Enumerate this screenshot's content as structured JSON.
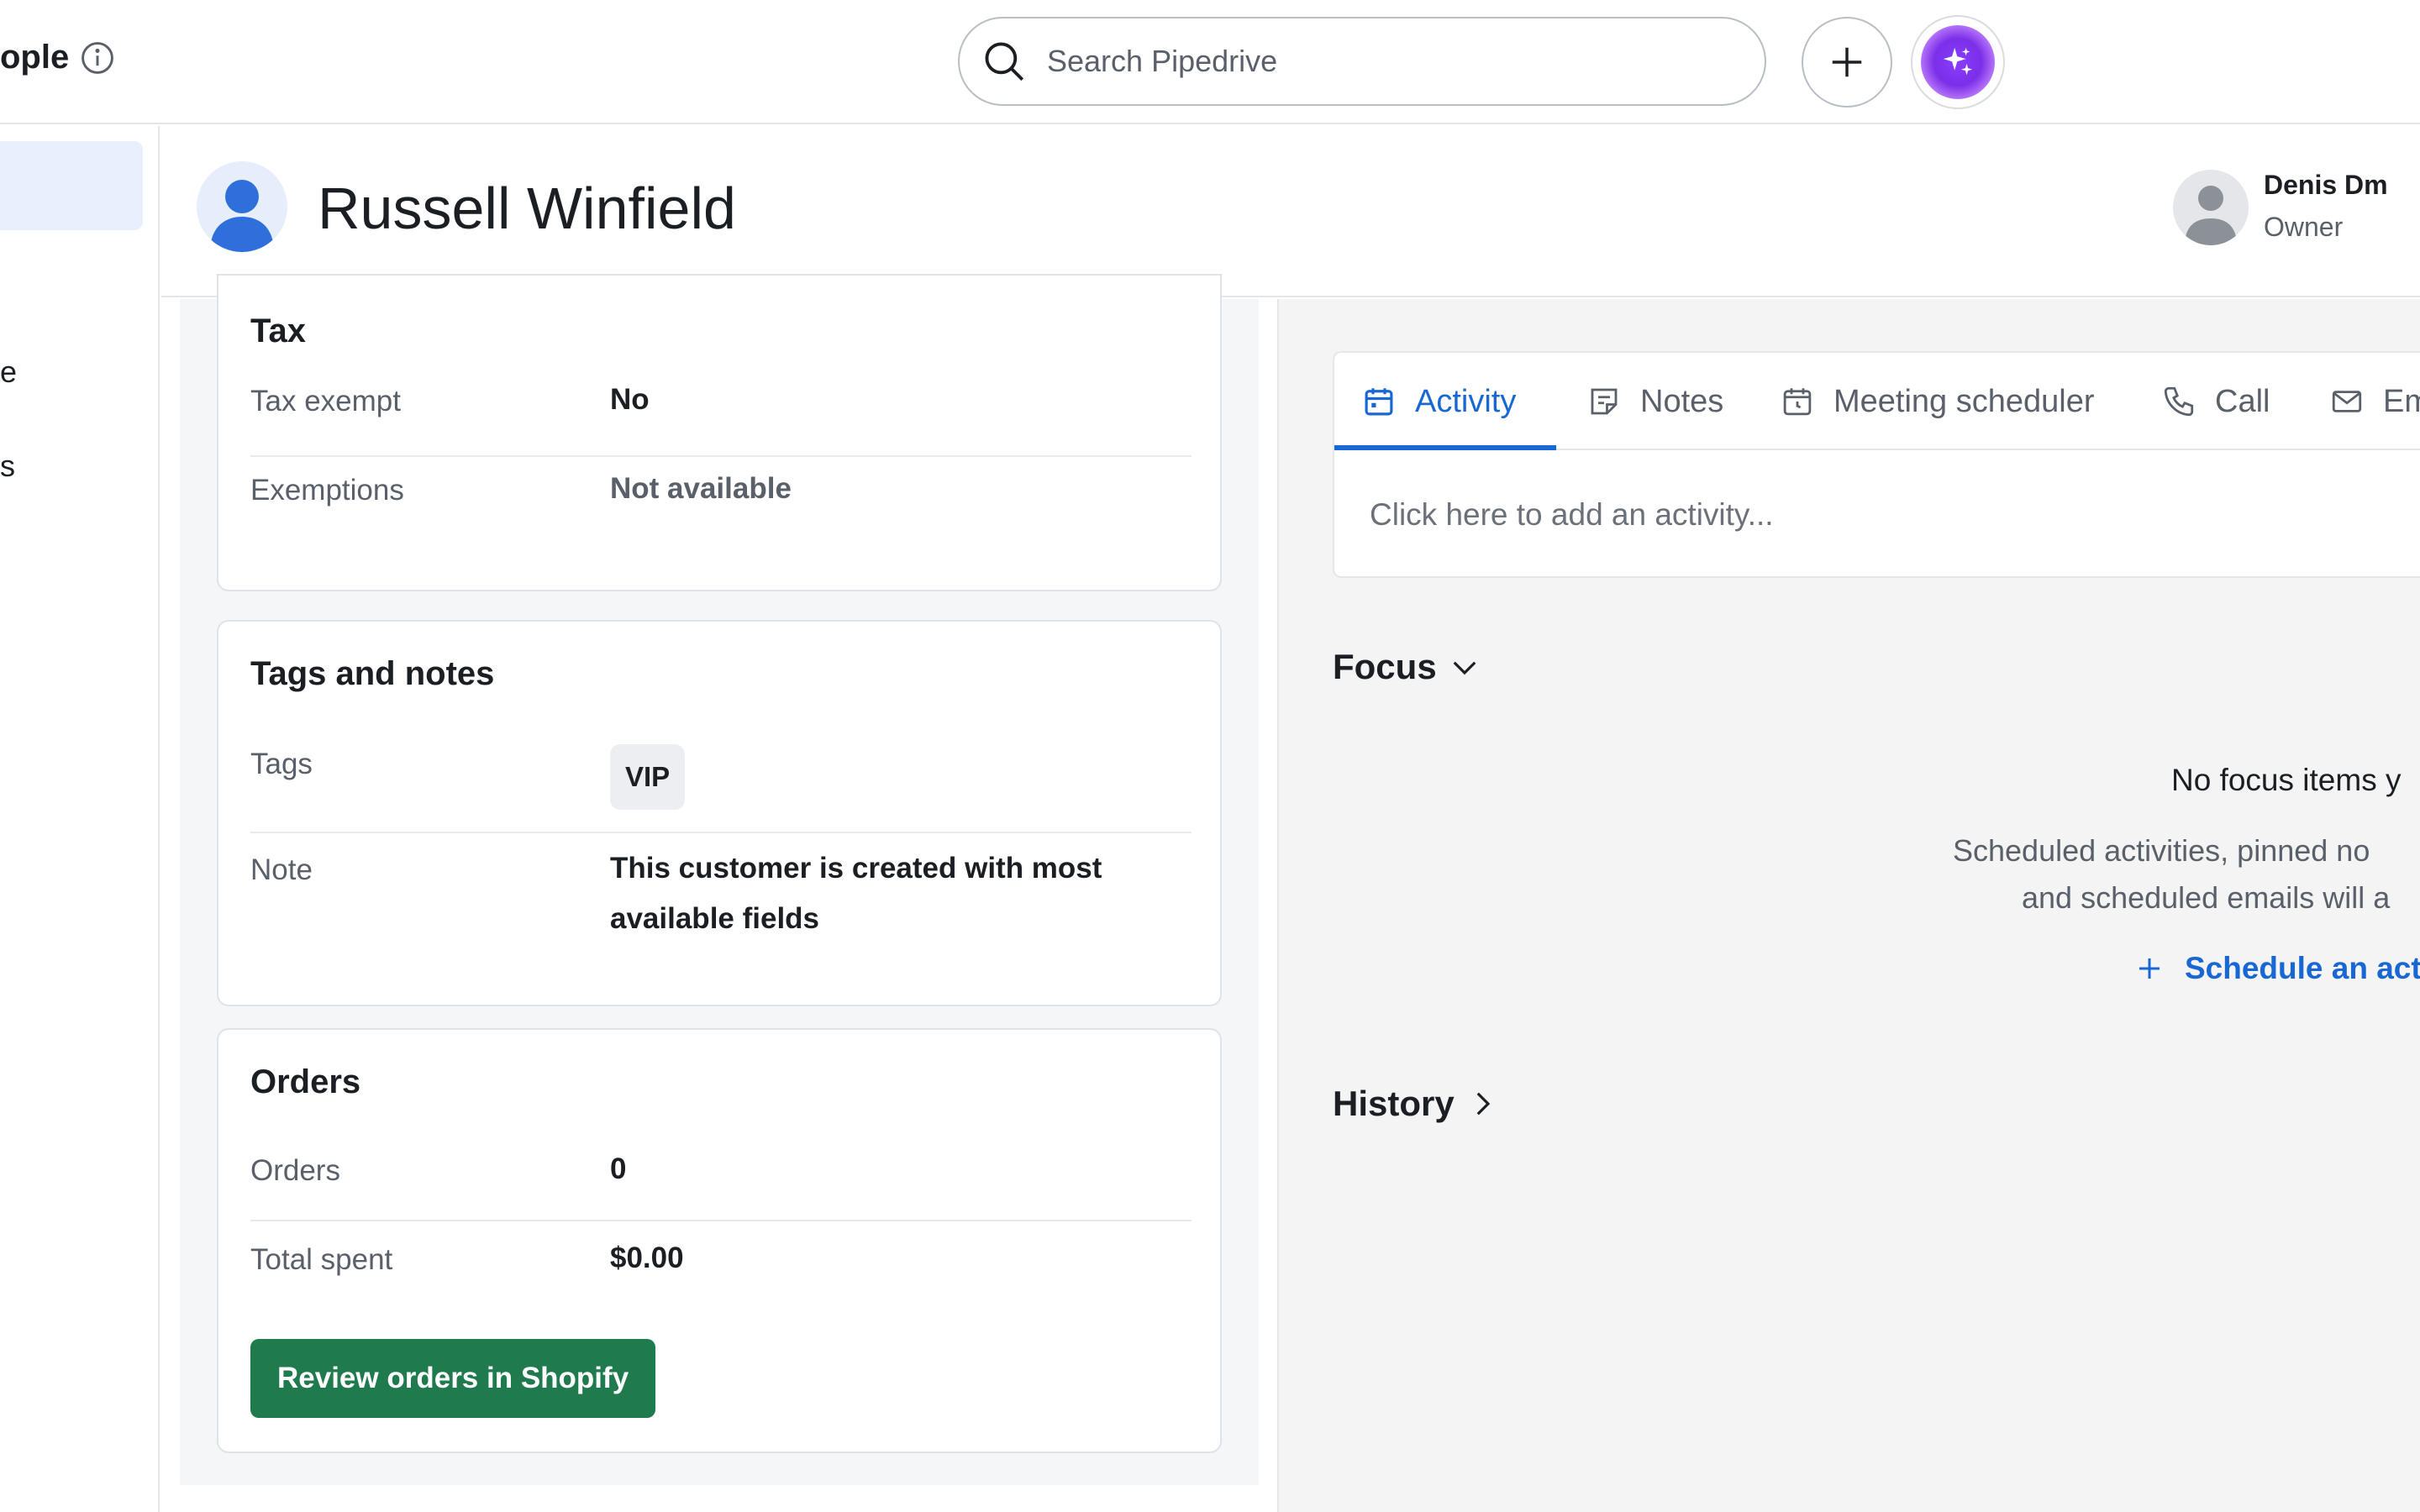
{
  "topbar": {
    "app_title": "ople",
    "search_placeholder": "Search Pipedrive"
  },
  "leftnav": {
    "fragments": [
      "e",
      "s"
    ]
  },
  "header": {
    "person_name": "Russell Winfield",
    "owner_name": "Denis Dm",
    "owner_role": "Owner"
  },
  "tax": {
    "title": "Tax",
    "rows": [
      {
        "label": "Tax exempt",
        "value": "No"
      },
      {
        "label": "Exemptions",
        "value": "Not available"
      }
    ]
  },
  "tags_notes": {
    "title": "Tags and notes",
    "tags_label": "Tags",
    "tag": "VIP",
    "note_label": "Note",
    "note_line1": "This customer is created with most",
    "note_line2": "available fields"
  },
  "orders": {
    "title": "Orders",
    "rows": [
      {
        "label": "Orders",
        "value": "0"
      },
      {
        "label": "Total spent",
        "value": "$0.00"
      }
    ],
    "review_button": "Review orders in Shopify"
  },
  "activity_panel": {
    "tabs": [
      {
        "label": "Activity",
        "icon": "calendar-icon"
      },
      {
        "label": "Notes",
        "icon": "note-icon"
      },
      {
        "label": "Meeting scheduler",
        "icon": "calendar-clock-icon"
      },
      {
        "label": "Call",
        "icon": "phone-icon"
      },
      {
        "label": "Em",
        "icon": "mail-icon"
      }
    ],
    "add_activity_placeholder": "Click here to add an activity..."
  },
  "focus": {
    "title": "Focus",
    "empty_title": "No focus items y",
    "empty_line1": "Scheduled activities, pinned no",
    "empty_line2": "and scheduled emails will a",
    "schedule_link": "Schedule an act"
  },
  "history": {
    "title": "History"
  },
  "colors": {
    "accent_blue": "#1967d2",
    "shopify_green": "#1f7a4d",
    "ai_purple": "#7a2fe8"
  }
}
